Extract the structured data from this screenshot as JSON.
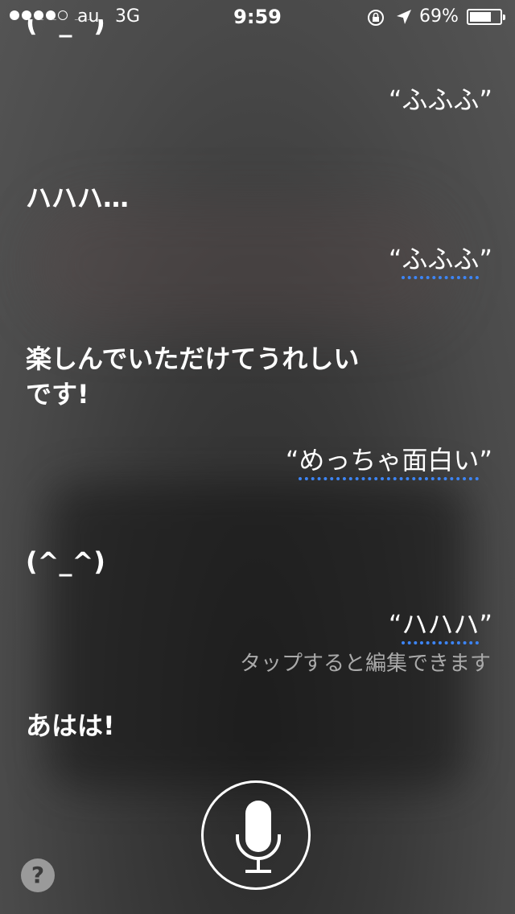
{
  "status": {
    "carrier": "au",
    "network": "3G",
    "time": "9:59",
    "battery": "69%",
    "battery_level": 0.69,
    "signal_bars": 4
  },
  "conversation": {
    "top_partial": "(^_^)",
    "user1": "“ふふふ”",
    "siri1": "ハハハ…",
    "user2_open": "“",
    "user2_text": "ふふふ",
    "user2_close": "”",
    "siri2_line1": "楽しんでいただけてうれしい",
    "siri2_line2": "です!",
    "user3_open": "“",
    "user3_text": "めっちゃ面白い",
    "user3_close": "”",
    "siri3": "(^_^)",
    "user4_open": "“",
    "user4_text": "ハハハ",
    "user4_close": "”",
    "tap_hint": "タップすると編集できます",
    "siri4": "あはは!"
  },
  "controls": {
    "help_label": "?"
  },
  "icons": [
    "rotation-lock-icon",
    "location-arrow-icon",
    "battery-icon",
    "microphone-icon",
    "help-icon"
  ]
}
